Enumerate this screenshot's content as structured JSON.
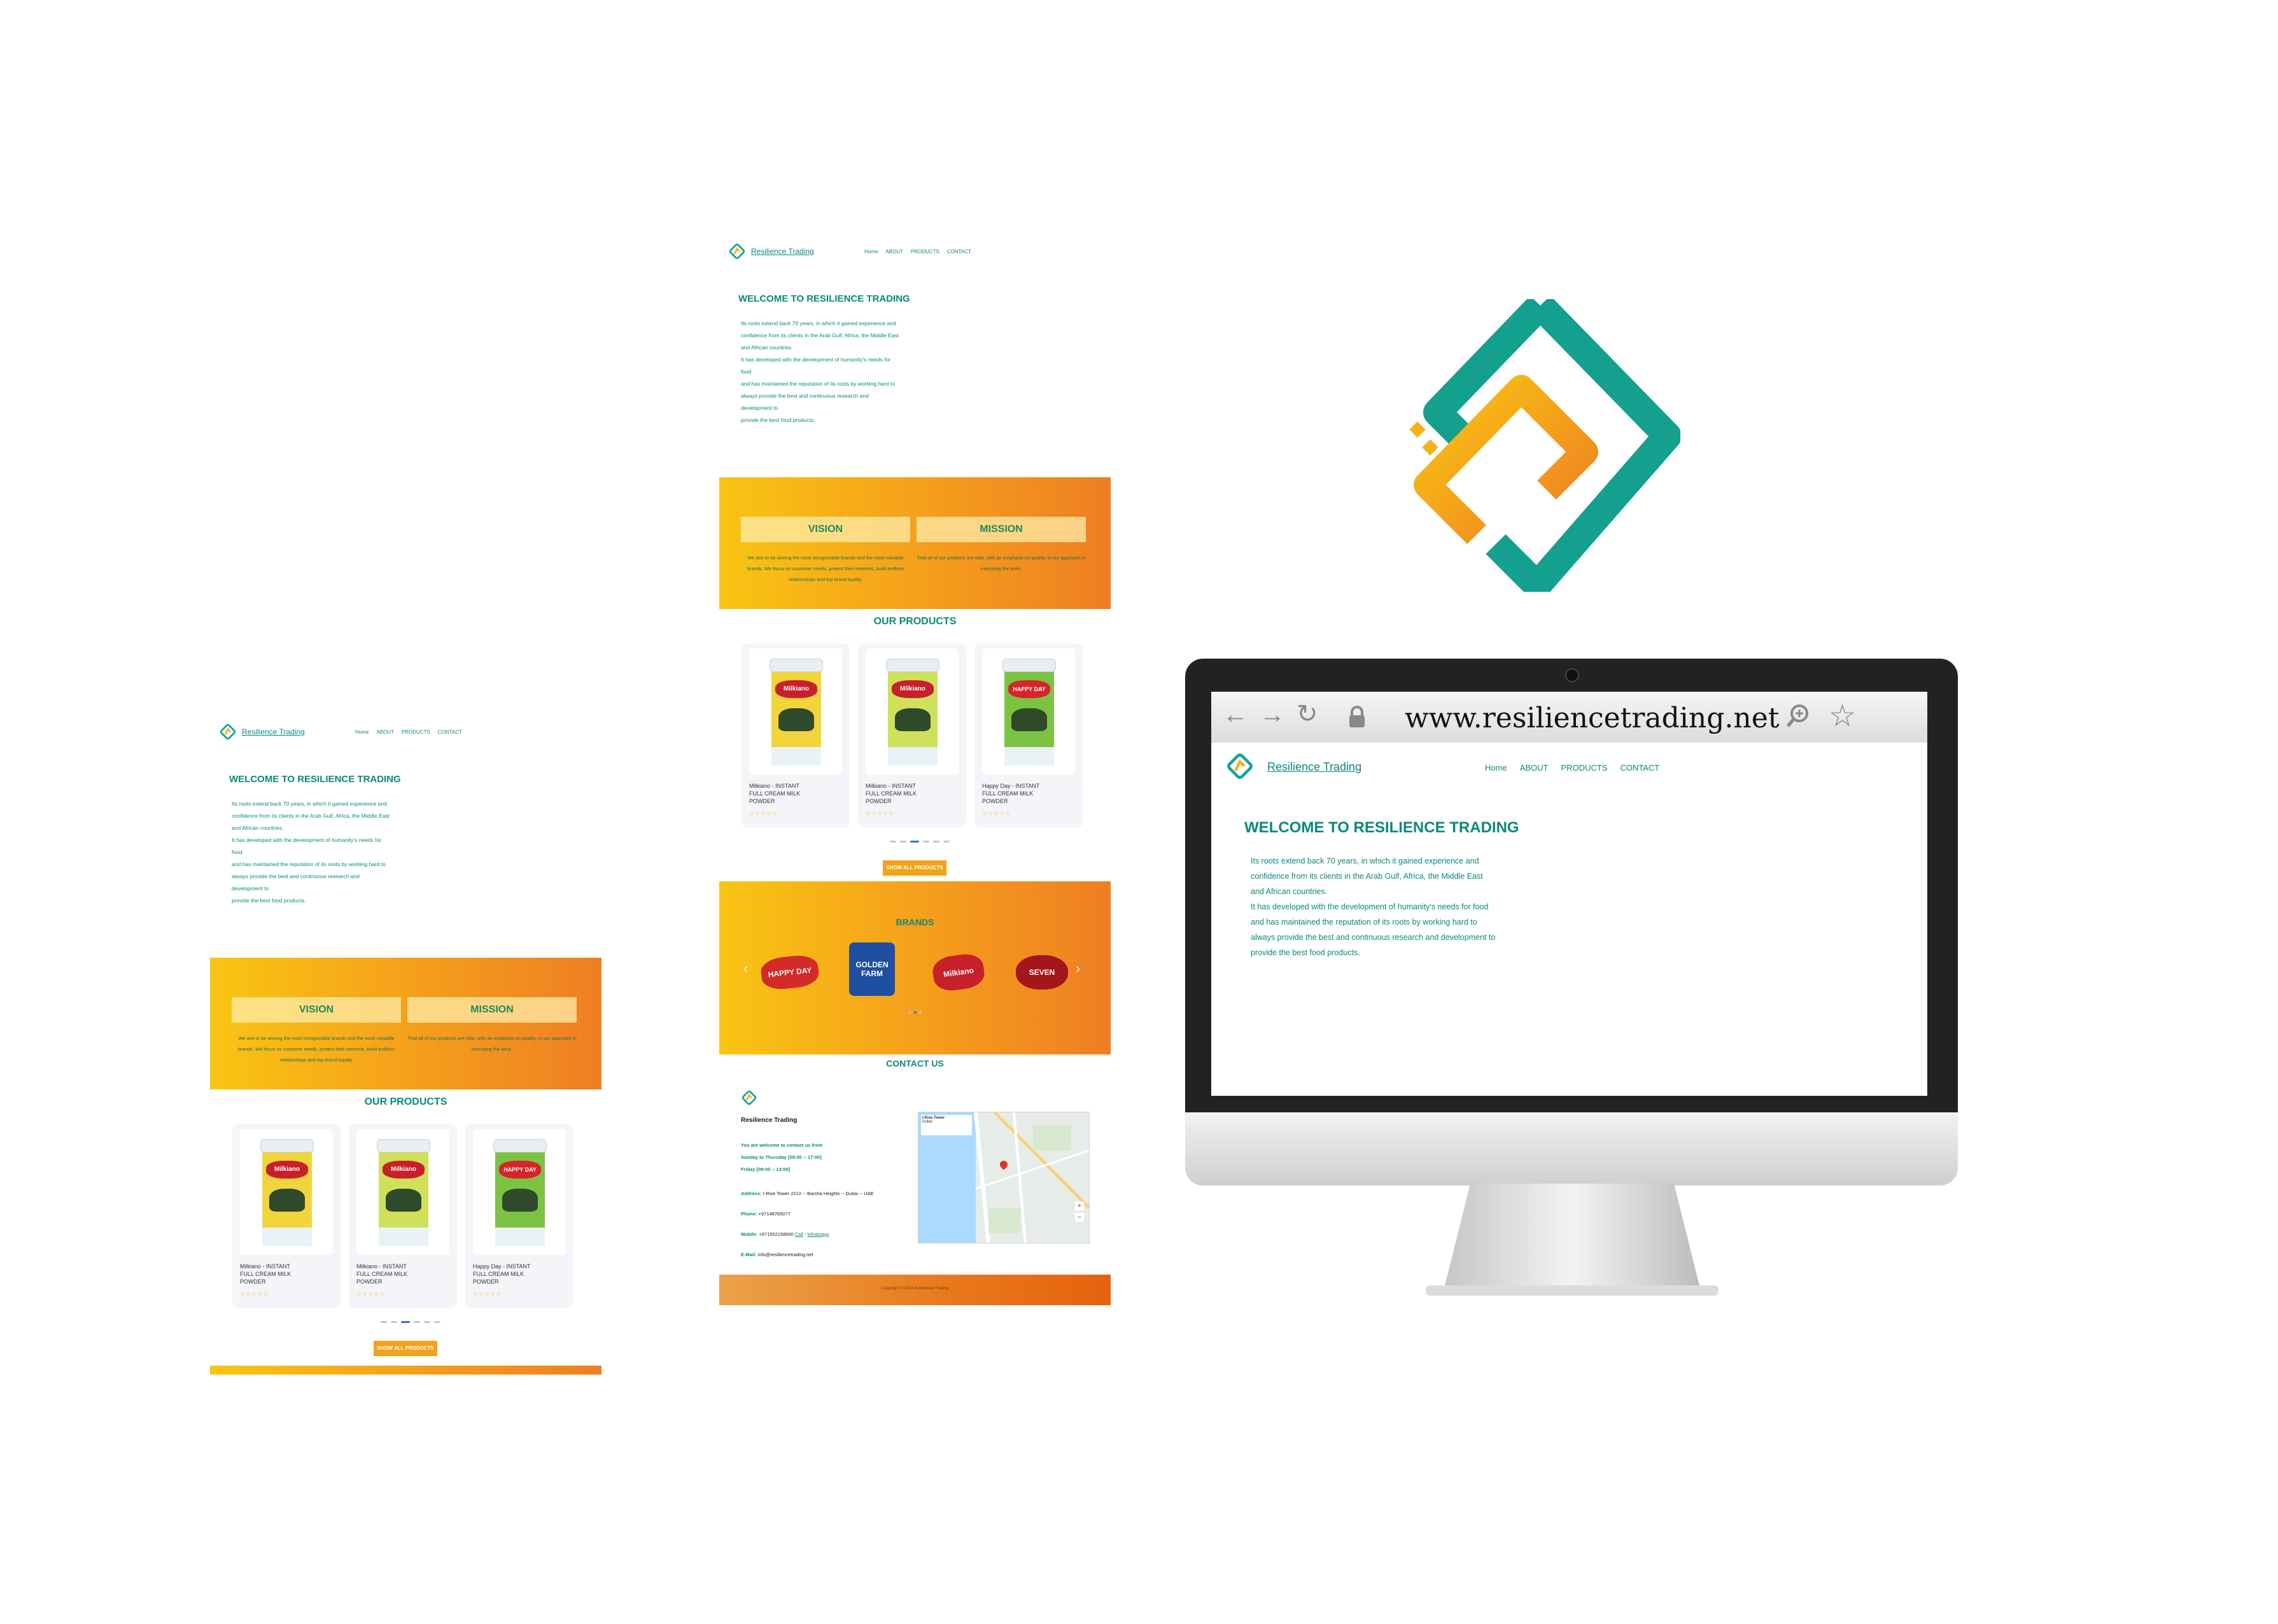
{
  "site": {
    "brand_name": "Resilience Trading",
    "nav": [
      "Home",
      "ABOUT",
      "PRODUCTS",
      "CONTACT"
    ],
    "welcome_title": "WELCOME TO RESILIENCE TRADING",
    "welcome_lines": [
      "Its roots extend back 70 years, in which it gained experience and",
      "confidence from its clients in the Arab Gulf, Africa, the Middle East",
      "and African countries.",
      "It has developed with the development of humanity's needs for food",
      "and has maintained the reputation of its roots by working hard to",
      "always provide the best and continuous research and development to",
      "provide the best food products."
    ],
    "vision_label": "VISION",
    "mission_label": "MISSION",
    "vision_text": "We aim to be among the most recognizable brands and the most valuable brands. We focus on customer needs, protect their interests, build endless relationships and top brand loyalty.",
    "mission_text": "That all of our products are elite, with an emphasis on quality, in our approach in executing the work.",
    "products_title": "OUR PRODUCTS",
    "products": [
      {
        "title_l1": "Milkiano - INSTANT",
        "title_l2": "FULL CREAM MILK",
        "title_l3": "POWDER",
        "can_label": "Milkiano",
        "color": "#c8202a",
        "body": "#f2d43c"
      },
      {
        "title_l1": "Milkiano - INSTANT",
        "title_l2": "FULL CREAM MILK",
        "title_l3": "POWDER",
        "can_label": "Milkiano",
        "color": "#c8202a",
        "body": "#cfe05a"
      },
      {
        "title_l1": "Happy Day - INSTANT",
        "title_l2": "FULL CREAM MILK",
        "title_l3": "POWDER",
        "can_label": "HAPPY DAY",
        "color": "#d6242a",
        "body": "#7cc243"
      }
    ],
    "stars": "☆☆☆☆☆",
    "show_all_label": "SHOW ALL PRODUCTS",
    "brands_title": "BRANDS",
    "brands": [
      "HAPPY DAY",
      "GOLDEN FARM",
      "Milkiano",
      "SEVEN"
    ],
    "contact_title": "CONTACT US",
    "contact": {
      "company": "Resilience Trading",
      "welcome": "You are welcome to contact us from",
      "hours1": "Sunday to Thursday [09:00 -- 17:00]",
      "hours2": "Friday [09:00 -- 13:00]",
      "address_label": "Address:",
      "address": "I-Rise Tower 2212 -- Barsha Heights -- Dubai -- UAE",
      "phone_label": "Phone:",
      "phone": "+97148765077",
      "mobile_label": "Mobile:",
      "mobile": "+971552158600",
      "call_link": "Call",
      "whatsapp_link": "Whatsapp",
      "email_label": "E-Mail:",
      "email": "info@resiliencetrading.net"
    },
    "map_label": "I-Rise Tower",
    "map_sublabel": "Dubai",
    "footer": "Copyright © 2023 Resilience Trading"
  },
  "browser": {
    "url": "www.resiliencetrading.net"
  },
  "icons": [
    "back-arrow-icon",
    "forward-arrow-icon",
    "reload-icon",
    "lock-icon",
    "zoom-icon",
    "star-icon"
  ],
  "colors": {
    "teal": "#0a8a78",
    "yellow": "#f9c512",
    "orange": "#ef7e22"
  }
}
